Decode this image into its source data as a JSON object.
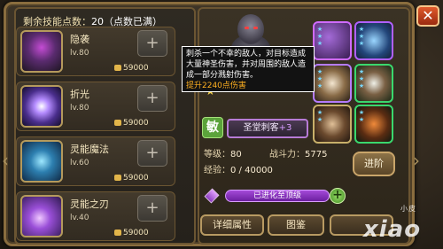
{
  "skills_panel": {
    "points_label": "剩余技能点数：",
    "points_value": "20（点数已满）",
    "skills": [
      {
        "name": "隐袭",
        "level": "lv.80",
        "cost": "59000",
        "icon": "hooded-assassin-icon"
      },
      {
        "name": "折光",
        "level": "lv.80",
        "cost": "59000",
        "icon": "light-burst-icon"
      },
      {
        "name": "灵能魔法",
        "level": "lv.60",
        "cost": "59000",
        "icon": "psionic-ring-icon"
      },
      {
        "name": "灵能之刃",
        "level": "lv.40",
        "cost": "59000",
        "icon": "psionic-blade-icon"
      }
    ],
    "plus_label": "+"
  },
  "tooltip": {
    "description": "刺杀一个不幸的敌人，对目标造成大量神圣伤害，并对周围的敌人造成一部分溅射伤害。",
    "bonus": "提升2240点伤害"
  },
  "hero": {
    "class_char": "敏",
    "title": "圣堂刺客",
    "title_plus": "+3",
    "level_label": "等级：",
    "level_value": "80",
    "power_label": "战斗力：",
    "power_value": "5775",
    "exp_label": "经验：",
    "exp_value": "0 / 40000"
  },
  "buttons": {
    "advance": "进阶",
    "evolved": "已进化至顶级",
    "detail": "详细属性",
    "atlas": "图鉴",
    "third": "",
    "close": "✕",
    "evolve_plus": "+"
  },
  "watermark": {
    "main": "xiao",
    "small": "小皮"
  },
  "colors": {
    "accent_gold": "#c9a56a",
    "purple": "#a44ad8",
    "green": "#5ba33b",
    "close_red": "#e05a2c"
  }
}
